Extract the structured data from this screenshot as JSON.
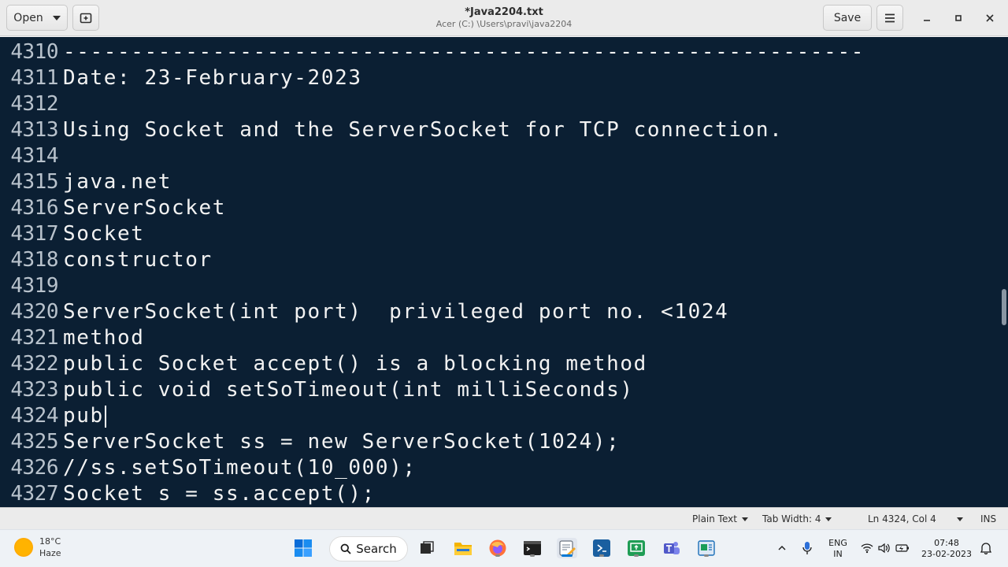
{
  "header": {
    "open_label": "Open",
    "save_label": "Save",
    "title": "*Java2204.txt",
    "subtitle": "Acer (C:) \\Users\\pravi\\java2204",
    "minimize": "–",
    "maximize": "▫",
    "close": "✕"
  },
  "editor": {
    "lines": [
      {
        "num": "4310",
        "text": "-----------------------------------------------------------"
      },
      {
        "num": "4311",
        "text": "Date: 23-February-2023"
      },
      {
        "num": "4312",
        "text": ""
      },
      {
        "num": "4313",
        "text": "Using Socket and the ServerSocket for TCP connection."
      },
      {
        "num": "4314",
        "text": ""
      },
      {
        "num": "4315",
        "text": "java.net"
      },
      {
        "num": "4316",
        "text": "ServerSocket"
      },
      {
        "num": "4317",
        "text": "Socket"
      },
      {
        "num": "4318",
        "text": "constructor"
      },
      {
        "num": "4319",
        "text": ""
      },
      {
        "num": "4320",
        "text": "ServerSocket(int port)  privileged port no. <1024"
      },
      {
        "num": "4321",
        "text": "method"
      },
      {
        "num": "4322",
        "text": "public Socket accept() is a blocking method"
      },
      {
        "num": "4323",
        "text": "public void setSoTimeout(int milliSeconds)"
      },
      {
        "num": "4324",
        "text": "pub"
      },
      {
        "num": "4325",
        "text": "ServerSocket ss = new ServerSocket(1024);"
      },
      {
        "num": "4326",
        "text": "//ss.setSoTimeout(10_000);"
      },
      {
        "num": "4327",
        "text": "Socket s = ss.accept();"
      }
    ]
  },
  "statusbar": {
    "language": "Plain Text",
    "tab_width": "Tab Width: 4",
    "position": "Ln 4324, Col 4",
    "mode": "INS"
  },
  "taskbar": {
    "temperature": "18°C",
    "weather": "Haze",
    "search_label": "Search",
    "lang_top": "ENG",
    "lang_bottom": "IN",
    "time": "07:48",
    "date": "23-02-2023"
  },
  "colors": {
    "editor_bg": "#0b1f33",
    "editor_text": "#f2f2f2",
    "line_numbers": "#b8c2cc",
    "header_bg": "#ebebeb"
  }
}
